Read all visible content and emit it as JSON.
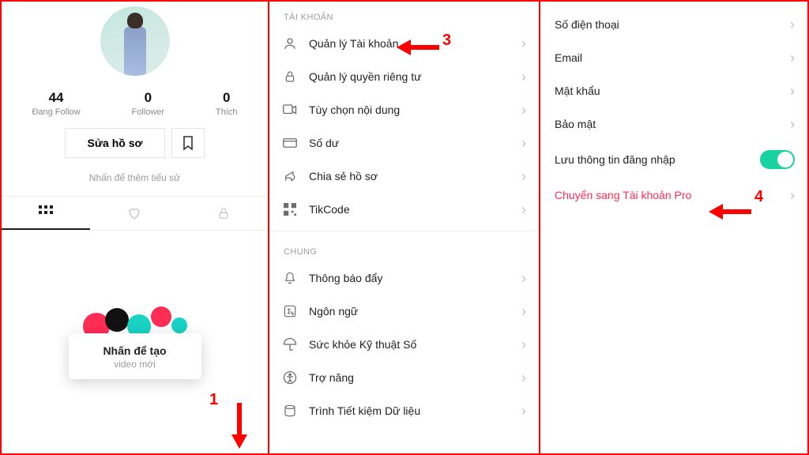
{
  "profile": {
    "stats": [
      {
        "value": "44",
        "label": "Đang Follow"
      },
      {
        "value": "0",
        "label": "Follower"
      },
      {
        "value": "0",
        "label": "Thích"
      }
    ],
    "edit_button": "Sửa hồ sơ",
    "add_bio": "Nhấn để thêm tiểu sử",
    "tooltip_title": "Nhấn để tạo",
    "tooltip_sub": "video mới"
  },
  "settings": {
    "sections": [
      {
        "header": "TÀI KHOẢN",
        "items": [
          {
            "icon": "person",
            "label": "Quản lý Tài khoản"
          },
          {
            "icon": "lock",
            "label": "Quản lý quyền riêng tư"
          },
          {
            "icon": "video",
            "label": "Tùy chọn nội dung"
          },
          {
            "icon": "wallet",
            "label": "Số dư"
          },
          {
            "icon": "share",
            "label": "Chia sẻ hồ sơ"
          },
          {
            "icon": "tikcode",
            "label": "TikCode"
          }
        ]
      },
      {
        "header": "CHUNG",
        "items": [
          {
            "icon": "bell",
            "label": "Thông báo đẩy"
          },
          {
            "icon": "language",
            "label": "Ngôn ngữ"
          },
          {
            "icon": "umbrella",
            "label": "Sức khỏe Kỹ thuật Số"
          },
          {
            "icon": "accessibility",
            "label": "Trợ năng"
          },
          {
            "icon": "data",
            "label": "Trình Tiết kiệm Dữ liệu"
          }
        ]
      }
    ]
  },
  "account": {
    "items": [
      {
        "label": "Số điện thoại",
        "type": "chevron"
      },
      {
        "label": "Email",
        "type": "chevron"
      },
      {
        "label": "Mật khẩu",
        "type": "chevron"
      },
      {
        "label": "Bảo mật",
        "type": "chevron"
      },
      {
        "label": "Lưu thông tin đăng nhập",
        "type": "toggle",
        "value": true
      },
      {
        "label": "Chuyển sang Tài khoản Pro",
        "type": "chevron",
        "highlight": true
      }
    ]
  },
  "annotations": {
    "n1": "1",
    "n3": "3",
    "n4": "4"
  }
}
